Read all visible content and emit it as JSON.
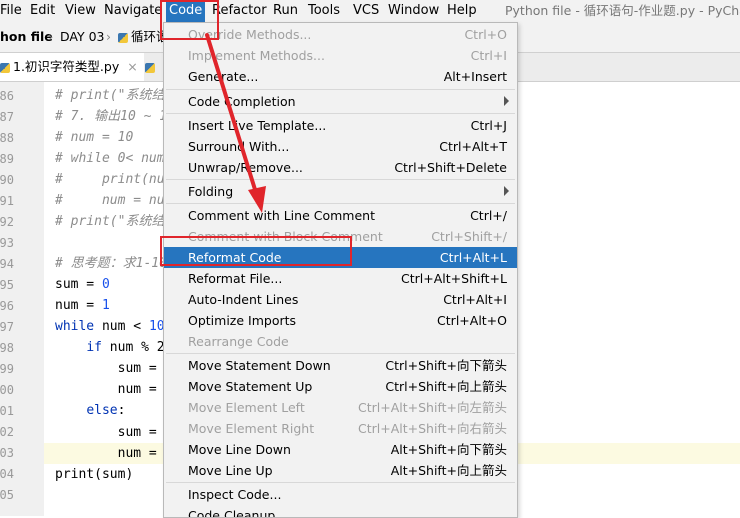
{
  "menubar": {
    "items": [
      "File",
      "Edit",
      "View",
      "Navigate",
      "Code",
      "Refactor",
      "Run",
      "Tools",
      "VCS",
      "Window",
      "Help"
    ],
    "window_title": "Python file - 循环语句-作业题.py - PyCharm"
  },
  "navbar": {
    "crumb1": "hon file",
    "crumb2": "DAY 03",
    "crumb3": "循环语"
  },
  "tabs": [
    "1.初识字符类型.py"
  ],
  "line_numbers": [
    "86",
    "87",
    "88",
    "89",
    "90",
    "91",
    "92",
    "93",
    "94",
    "95",
    "96",
    "97",
    "98",
    "99",
    "00",
    "01",
    "02",
    "03",
    "04",
    "05"
  ],
  "code": {
    "l86": "# print(\"系统结",
    "l87": "# 7. 输出10 ~ 1",
    "l88": "# num = 10",
    "l89": "# while 0< num",
    "l90": "#     print(nu",
    "l91": "#     num = nu",
    "l92": "# print(\"系统结",
    "l94": "# 思考题：求1-10",
    "l95": [
      "sum",
      " = ",
      "0"
    ],
    "l96": [
      "num",
      " = ",
      "1"
    ],
    "l97": [
      "while",
      " num < ",
      "10"
    ],
    "l98": [
      "    ",
      "if",
      " num % 2"
    ],
    "l99": "        sum = ",
    "l00": "        num = ",
    "l01": [
      "    ",
      "else",
      ":"
    ],
    "l02": "        sum = ",
    "l03": "        num = ",
    "l04": "print(sum)"
  },
  "menu": {
    "items": [
      {
        "label": "Override Methods...",
        "shortcut": "Ctrl+O",
        "disabled": true
      },
      {
        "label": "Implement Methods...",
        "shortcut": "Ctrl+I",
        "disabled": true
      },
      {
        "label": "Generate...",
        "shortcut": "Alt+Insert",
        "disabled": false
      },
      {
        "label": "Code Completion",
        "shortcut": "",
        "disabled": false,
        "submenu": true
      },
      {
        "label": "Insert Live Template...",
        "shortcut": "Ctrl+J",
        "disabled": false
      },
      {
        "label": "Surround With...",
        "shortcut": "Ctrl+Alt+T",
        "disabled": false
      },
      {
        "label": "Unwrap/Remove...",
        "shortcut": "Ctrl+Shift+Delete",
        "disabled": false
      },
      {
        "label": "Folding",
        "shortcut": "",
        "disabled": false,
        "submenu": true
      },
      {
        "label": "Comment with Line Comment",
        "shortcut": "Ctrl+/",
        "disabled": false
      },
      {
        "label": "Comment with Block Comment",
        "shortcut": "Ctrl+Shift+/",
        "disabled": true
      },
      {
        "label": "Reformat Code",
        "shortcut": "Ctrl+Alt+L",
        "disabled": false,
        "selected": true
      },
      {
        "label": "Reformat File...",
        "shortcut": "Ctrl+Alt+Shift+L",
        "disabled": false
      },
      {
        "label": "Auto-Indent Lines",
        "shortcut": "Ctrl+Alt+I",
        "disabled": false
      },
      {
        "label": "Optimize Imports",
        "shortcut": "Ctrl+Alt+O",
        "disabled": false
      },
      {
        "label": "Rearrange Code",
        "shortcut": "",
        "disabled": true
      },
      {
        "label": "Move Statement Down",
        "shortcut": "Ctrl+Shift+向下箭头",
        "disabled": false
      },
      {
        "label": "Move Statement Up",
        "shortcut": "Ctrl+Shift+向上箭头",
        "disabled": false
      },
      {
        "label": "Move Element Left",
        "shortcut": "Ctrl+Alt+Shift+向左箭头",
        "disabled": true
      },
      {
        "label": "Move Element Right",
        "shortcut": "Ctrl+Alt+Shift+向右箭头",
        "disabled": true
      },
      {
        "label": "Move Line Down",
        "shortcut": "Alt+Shift+向下箭头",
        "disabled": false
      },
      {
        "label": "Move Line Up",
        "shortcut": "Alt+Shift+向上箭头",
        "disabled": false
      },
      {
        "label": "Inspect Code...",
        "shortcut": "",
        "disabled": false
      },
      {
        "label": "Code Cleanup...",
        "shortcut": "",
        "disabled": false
      }
    ]
  },
  "colors": {
    "selection": "#2675bf",
    "annotation": "#e0252b",
    "comment": "#8c8c8c",
    "keyword": "#0033b3",
    "number": "#1750eb"
  }
}
